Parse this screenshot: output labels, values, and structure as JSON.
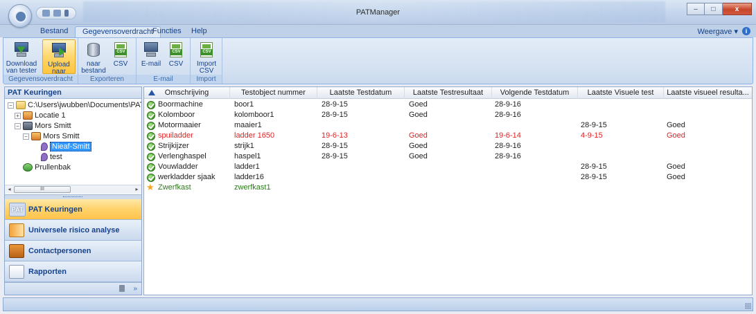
{
  "window": {
    "title": "PATManager"
  },
  "ribbon": {
    "tabs": [
      "Bestand",
      "Gegevensoverdracht",
      "Functies",
      "Help"
    ],
    "active_tab": "Gegevensoverdracht",
    "view_label": "Weergave",
    "view_chevron": "▾",
    "help_glyph": "i",
    "groups": [
      {
        "caption": "Gegevensoverdracht",
        "buttons": [
          {
            "label1": "Download",
            "label2": "van tester",
            "icon": "pc-download-icon"
          },
          {
            "label1": "Upload",
            "label2": "naar tester",
            "icon": "pc-upload-icon",
            "highlighted": true
          }
        ]
      },
      {
        "caption": "Exporteren",
        "buttons": [
          {
            "label1": "naar",
            "label2": "bestand",
            "icon": "disk-icon"
          },
          {
            "label1": "CSV",
            "label2": "",
            "icon": "csv-icon"
          }
        ]
      },
      {
        "caption": "E-mail",
        "buttons": [
          {
            "label1": "E-mail",
            "label2": "",
            "icon": "email-pc-icon"
          },
          {
            "label1": "CSV",
            "label2": "",
            "icon": "csv-icon"
          }
        ]
      },
      {
        "caption": "Import",
        "buttons": [
          {
            "label1": "Import",
            "label2": "CSV",
            "icon": "csv-icon"
          }
        ]
      }
    ],
    "csv_tag": "CSV"
  },
  "left_pane": {
    "header": "PAT Keuringen",
    "tree": [
      {
        "label": "C:\\Users\\jwubben\\Documents\\PATMa",
        "icon": "folder-icon",
        "expander": "−"
      },
      {
        "label": "Locatie 1",
        "icon": "house-icon",
        "expander": "+"
      },
      {
        "label": "Mors Smitt",
        "icon": "building-icon",
        "expander": "−"
      },
      {
        "label": "Mors Smitt",
        "icon": "house-icon",
        "expander": "−"
      },
      {
        "label": "Nieaf-Smitt",
        "icon": "pin-icon",
        "expander": "",
        "selected": true
      },
      {
        "label": "test",
        "icon": "pin-icon",
        "expander": ""
      },
      {
        "label": "Prullenbak",
        "icon": "recycle-icon",
        "expander": ""
      }
    ],
    "scroll_left": "◂",
    "scroll_right": "▸",
    "scroll_thumb": "III",
    "nav_buttons": [
      {
        "label": "PAT Keuringen",
        "icon": "pat-icon",
        "icon_text": "PAT",
        "active": true
      },
      {
        "label": "Universele risico analyse",
        "icon": "risk-analysis-icon"
      },
      {
        "label": "Contactpersonen",
        "icon": "contacts-book-icon"
      },
      {
        "label": "Rapporten",
        "icon": "report-icon"
      }
    ],
    "footer_chevron": "»"
  },
  "grid": {
    "columns": [
      "Omschrijving",
      "Testobject nummer",
      "Laatste Testdatum",
      "Laatste Testresultaat",
      "Volgende Testdatum",
      "Laatste Visuele test",
      "Laatste visueel resulta..."
    ],
    "rows": [
      {
        "status": "ok",
        "desc": "Boormachine",
        "nr": "boor1",
        "last_date": "28-9-15",
        "result": "Goed",
        "next_date": "28-9-16",
        "visual_date": "",
        "visual_result": "",
        "color": "normal"
      },
      {
        "status": "ok",
        "desc": "Kolomboor",
        "nr": "kolomboor1",
        "last_date": "28-9-15",
        "result": "Goed",
        "next_date": "28-9-16",
        "visual_date": "",
        "visual_result": "",
        "color": "normal"
      },
      {
        "status": "ok",
        "desc": "Motormaaier",
        "nr": "maaier1",
        "last_date": "",
        "result": "",
        "next_date": "",
        "visual_date": "28-9-15",
        "visual_result": "Goed",
        "color": "normal"
      },
      {
        "status": "ok",
        "desc": "spuiladder",
        "nr": "ladder 1650",
        "last_date": "19-6-13",
        "result": "Goed",
        "next_date": "19-6-14",
        "visual_date": "4-9-15",
        "visual_result": "Goed",
        "color": "red"
      },
      {
        "status": "ok",
        "desc": "Strijkijzer",
        "nr": "strijk1",
        "last_date": "28-9-15",
        "result": "Goed",
        "next_date": "28-9-16",
        "visual_date": "",
        "visual_result": "",
        "color": "normal"
      },
      {
        "status": "ok",
        "desc": "Verlenghaspel",
        "nr": "haspel1",
        "last_date": "28-9-15",
        "result": "Goed",
        "next_date": "28-9-16",
        "visual_date": "",
        "visual_result": "",
        "color": "normal"
      },
      {
        "status": "ok",
        "desc": "Vouwladder",
        "nr": "ladder1",
        "last_date": "",
        "result": "",
        "next_date": "",
        "visual_date": "28-9-15",
        "visual_result": "Goed",
        "color": "normal"
      },
      {
        "status": "ok",
        "desc": "werkladder sjaak",
        "nr": "ladder16",
        "last_date": "",
        "result": "",
        "next_date": "",
        "visual_date": "28-9-15",
        "visual_result": "Goed",
        "color": "normal"
      },
      {
        "status": "star",
        "desc": "Zwerfkast",
        "nr": "zwerfkast1",
        "last_date": "",
        "result": "",
        "next_date": "",
        "visual_date": "",
        "visual_result": "",
        "color": "green"
      }
    ]
  },
  "colors": {
    "overdue": "#e02020",
    "unassigned": "#2c7a1a",
    "selection": "#3399ff",
    "ribbon_text": "#15428b"
  },
  "window_controls": {
    "minimize": "–",
    "maximize": "□",
    "close": "x"
  },
  "status_icons": {
    "ok": "✓",
    "star": "★"
  }
}
